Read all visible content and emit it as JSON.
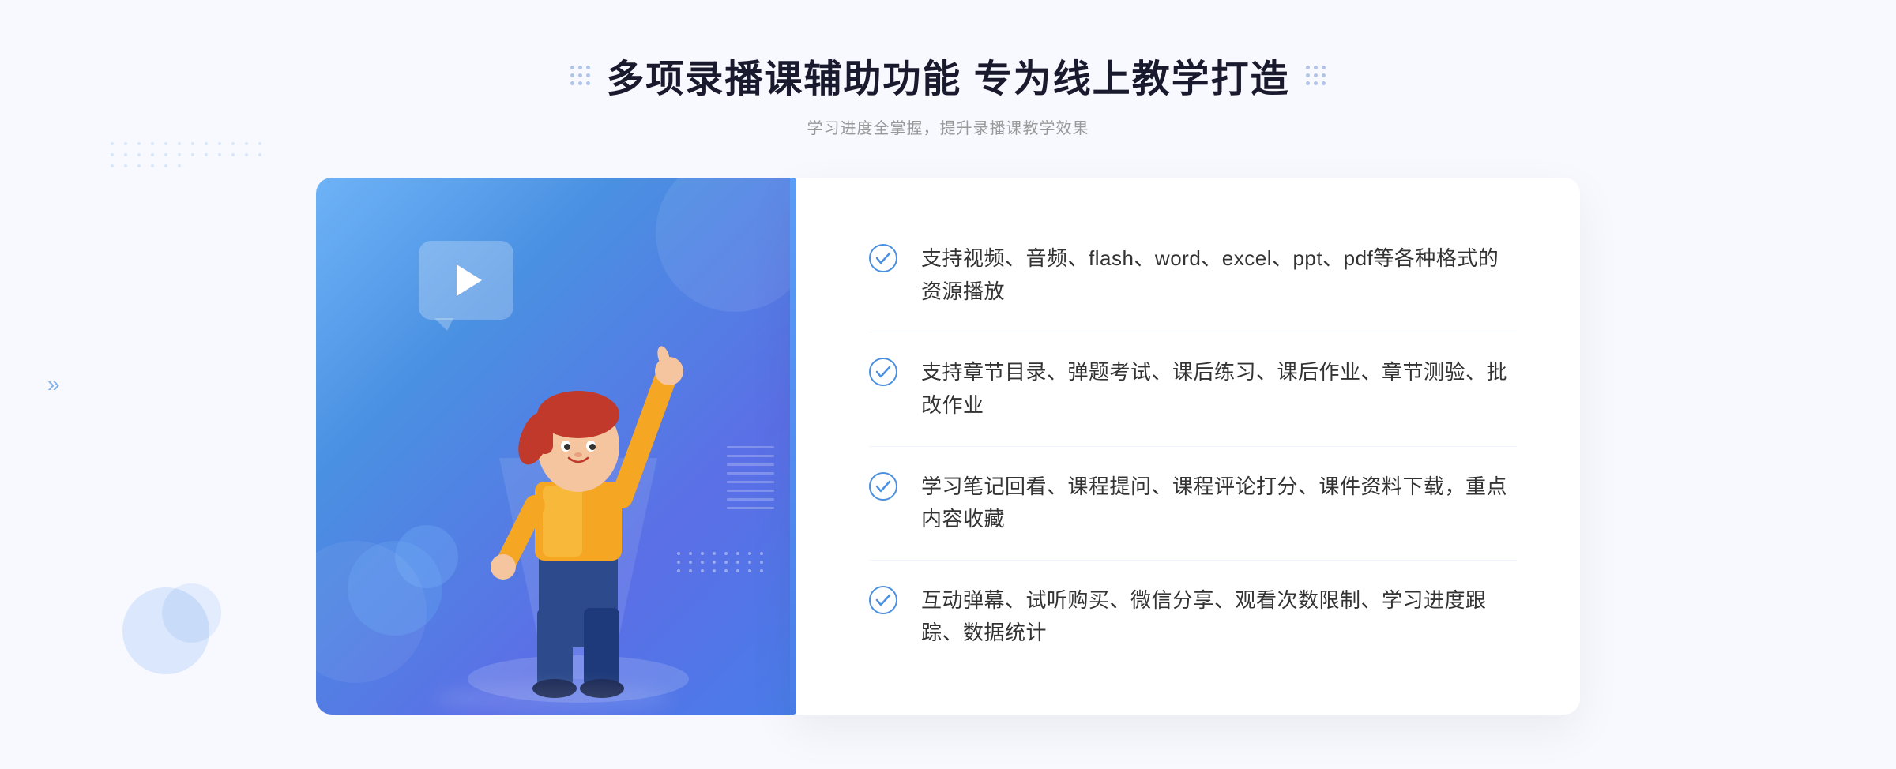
{
  "header": {
    "title": "多项录播课辅助功能 专为线上教学打造",
    "subtitle": "学习进度全掌握，提升录播课教学效果",
    "left_dots_label": "decorative-dots-left",
    "right_dots_label": "decorative-dots-right"
  },
  "features": [
    {
      "id": 1,
      "text": "支持视频、音频、flash、word、excel、ppt、pdf等各种格式的资源播放"
    },
    {
      "id": 2,
      "text": "支持章节目录、弹题考试、课后练习、课后作业、章节测验、批改作业"
    },
    {
      "id": 3,
      "text": "学习笔记回看、课程提问、课程评论打分、课件资料下载，重点内容收藏"
    },
    {
      "id": 4,
      "text": "互动弹幕、试听购买、微信分享、观看次数限制、学习进度跟踪、数据统计"
    }
  ],
  "colors": {
    "primary": "#4a90e2",
    "secondary": "#5b6fe6",
    "accent": "#5b9cf6",
    "text_dark": "#1a1a2e",
    "text_medium": "#333333",
    "text_light": "#999999",
    "bg_light": "#f8f9ff",
    "check_color": "#4a90e2"
  },
  "illustration": {
    "play_icon": "▶",
    "chevron_left": "«",
    "dot_decoration": true
  }
}
